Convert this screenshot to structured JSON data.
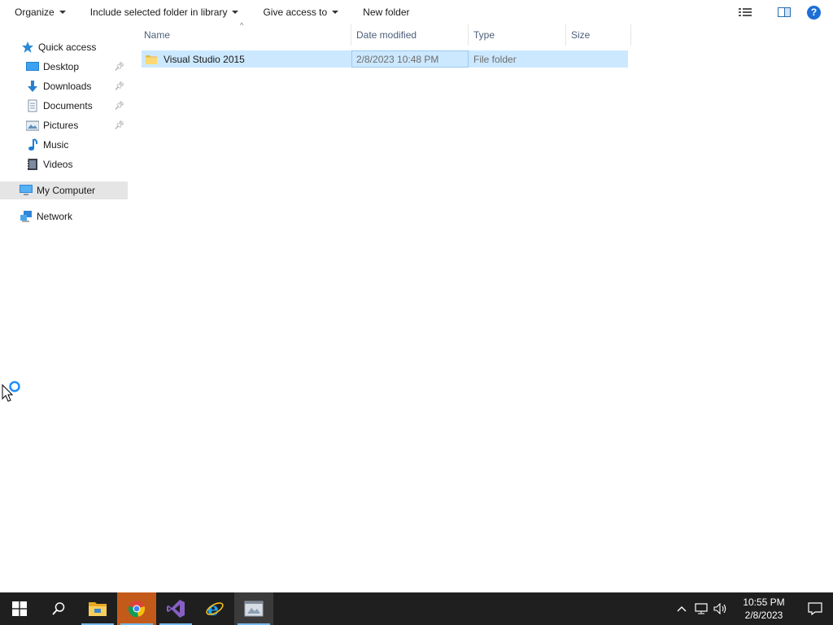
{
  "toolbar": {
    "organize": "Organize",
    "include_library": "Include selected folder in library",
    "give_access": "Give access to",
    "new_folder": "New folder",
    "help": "?"
  },
  "nav": {
    "quick_access": "Quick access",
    "items": [
      {
        "label": "Desktop",
        "icon": "desktop-icon",
        "pinned": true
      },
      {
        "label": "Downloads",
        "icon": "downloads-icon",
        "pinned": true
      },
      {
        "label": "Documents",
        "icon": "documents-icon",
        "pinned": true
      },
      {
        "label": "Pictures",
        "icon": "pictures-icon",
        "pinned": true
      },
      {
        "label": "Music",
        "icon": "music-icon",
        "pinned": false
      },
      {
        "label": "Videos",
        "icon": "videos-icon",
        "pinned": false
      }
    ],
    "my_computer": "My Computer",
    "network": "Network"
  },
  "columns": {
    "name": "Name",
    "date_modified": "Date modified",
    "type": "Type",
    "size": "Size"
  },
  "files": [
    {
      "name": "Visual Studio 2015",
      "date_modified": "2/8/2023 10:48 PM",
      "type": "File folder",
      "size": ""
    }
  ],
  "taskbar": {
    "apps": [
      "start-icon",
      "search-icon",
      "file-explorer-icon",
      "chrome-icon",
      "visual-studio-icon",
      "internet-explorer-icon",
      "app-window-icon"
    ],
    "time": "10:55 PM",
    "date": "2/8/2023"
  },
  "colors": {
    "selection": "#cce8ff",
    "nav_selected": "#e5e5e5",
    "taskbar": "#1f1f1f",
    "accent": "#1c6fd6"
  }
}
